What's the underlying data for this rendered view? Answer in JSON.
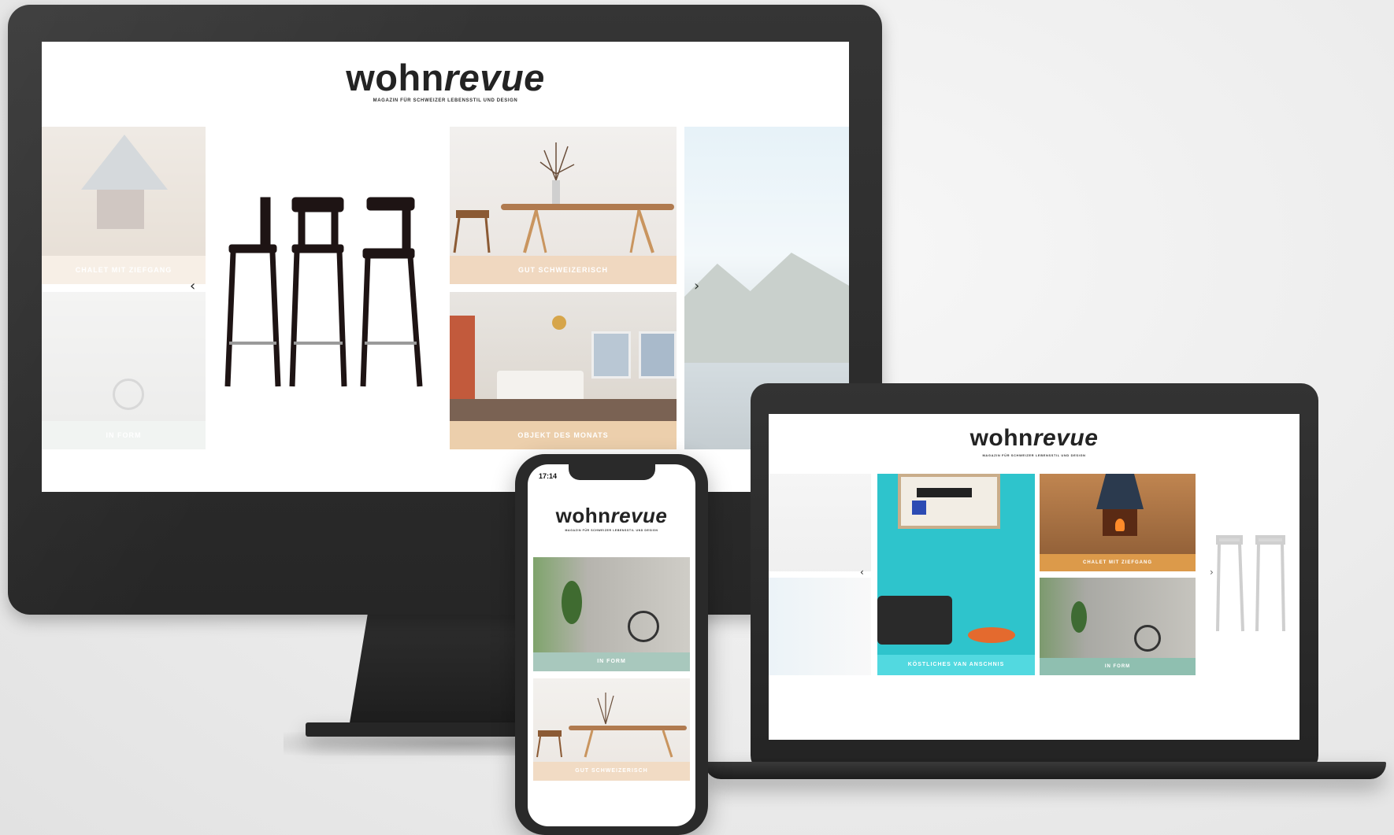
{
  "brand": {
    "name_part1": "wohn",
    "name_part2": "revue",
    "tagline": "MAGAZIN FÜR SCHWEIZER LEBENSSTIL UND DESIGN"
  },
  "phone": {
    "time": "17:14"
  },
  "tiles": {
    "chalet": "CHALET MIT ZIEFGANG",
    "gut_schweizerisch": "GUT SCHWEIZERISCH",
    "objekt_des_monats": "OBJEKT DES MONATS",
    "in_form": "IN FORM",
    "kostliches": "KÖSTLICHES VAN ANSCHNIS",
    "chalet_laptop": "CHALET MIT ZIEFGANG"
  },
  "nav": {
    "prev": "‹",
    "next": "›"
  },
  "colors": {
    "device": "#2b2b2b",
    "screen": "#ffffff",
    "caption_peach": "#eecfb0",
    "caption_mint": "#9fc7bb",
    "caption_cyan": "#4fd0d8",
    "caption_orange": "#e2a14e"
  }
}
